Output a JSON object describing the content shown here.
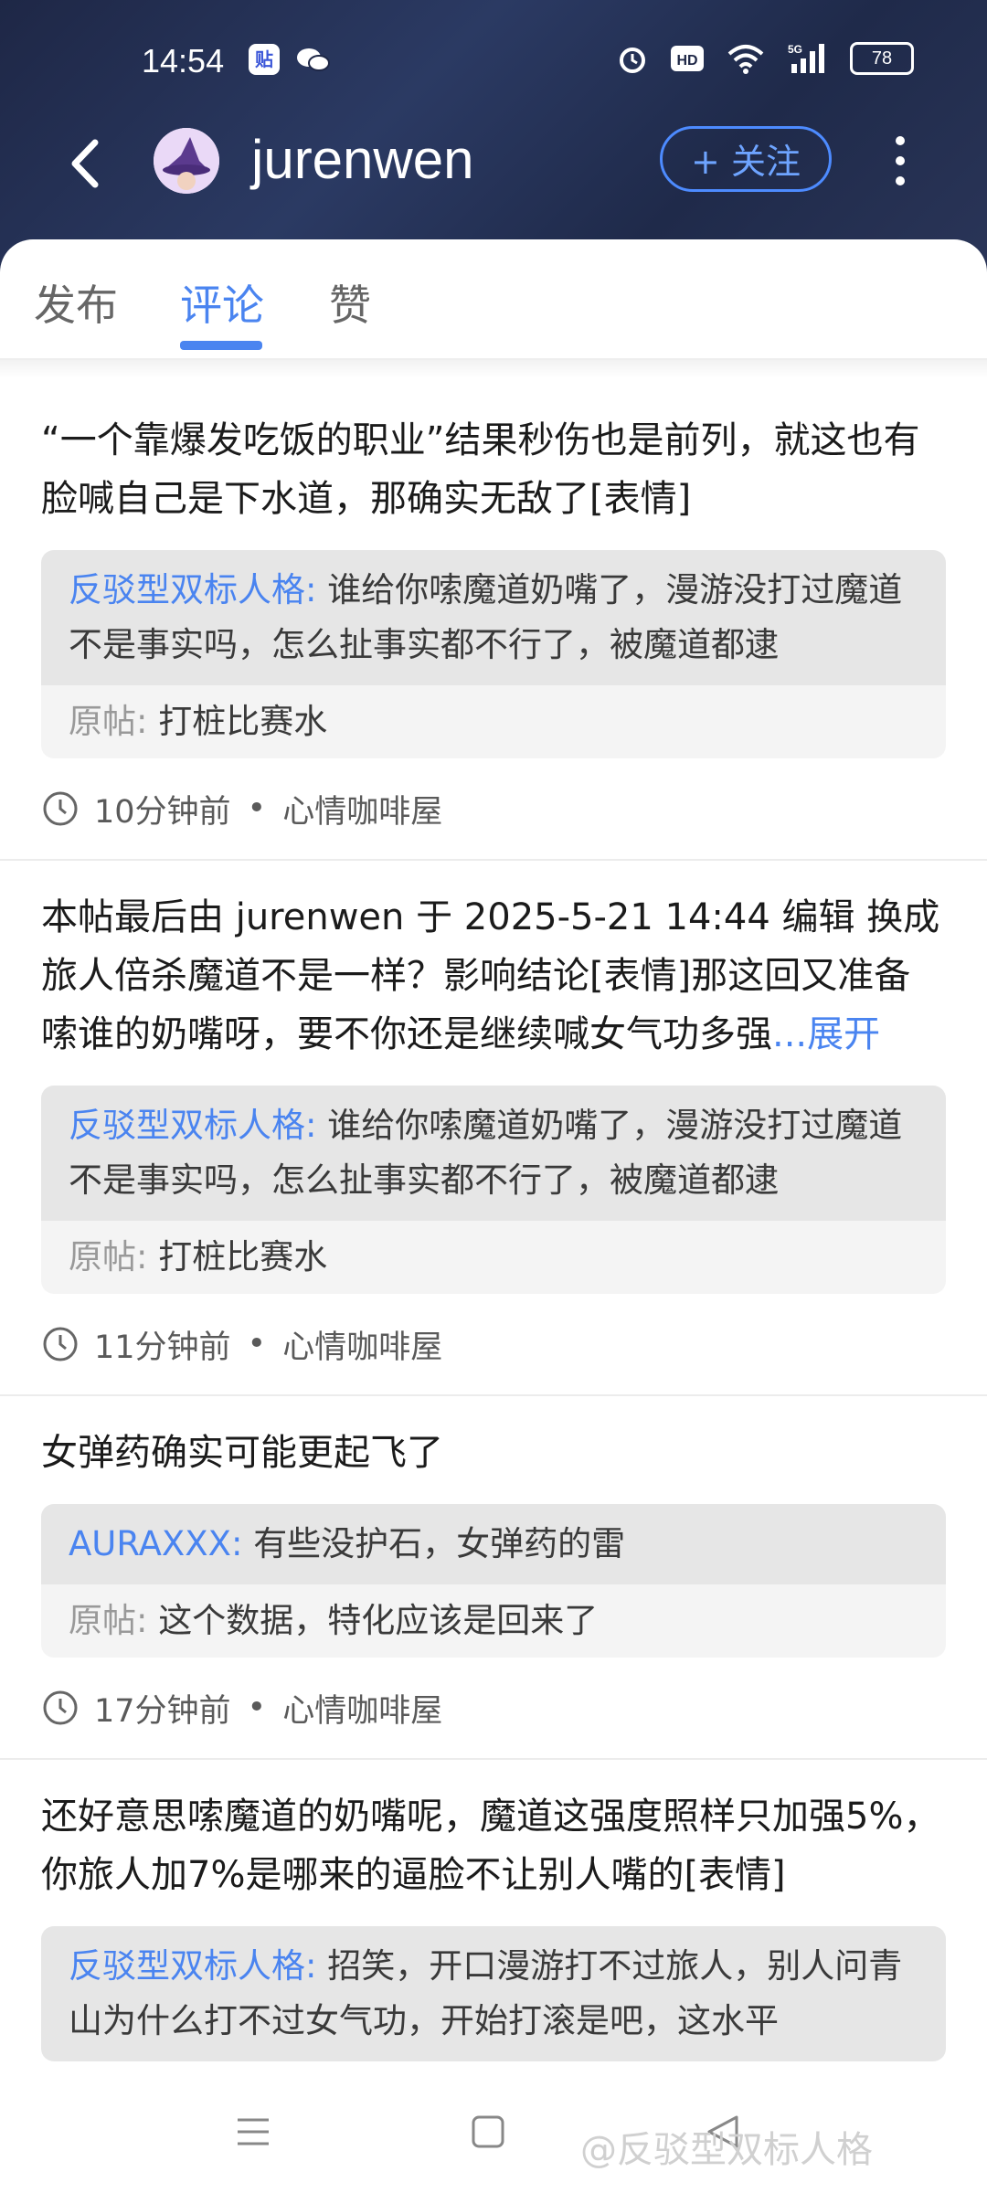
{
  "status_bar": {
    "time": "14:54",
    "app_icon_label": "贴",
    "signal_label": "5G",
    "battery": "78"
  },
  "header": {
    "username": "jurenwen",
    "follow_label": "+ 关注"
  },
  "tabs": [
    {
      "label": "发布"
    },
    {
      "label": "评论"
    },
    {
      "label": "赞"
    }
  ],
  "posts": [
    {
      "text": "“一个靠爆发吃饭的职业”结果秒伤也是前列，就这也有脸喊自己是下水道，那确实无敌了[表情]",
      "expand_label": "",
      "reply_name": "反驳型双标人格:",
      "reply_text": "谁给你嗦魔道奶嘴了，漫游没打过魔道不是事实吗，怎么扯事实都不行了，被魔道都逮",
      "orig_label": "原帖:",
      "orig_text": "打桩比赛水",
      "time": "10分钟前",
      "forum": "心情咖啡屋"
    },
    {
      "text": "本帖最后由 jurenwen 于 2025-5-21 14:44 编辑 换成旅人倍杀魔道不是一样？影响结论[表情]那这回又准备嗦谁的奶嘴呀，要不你还是继续喊女气功多强",
      "expand_label": "...展开",
      "reply_name": "反驳型双标人格:",
      "reply_text": "谁给你嗦魔道奶嘴了，漫游没打过魔道不是事实吗，怎么扯事实都不行了，被魔道都逮",
      "orig_label": "原帖:",
      "orig_text": "打桩比赛水",
      "time": "11分钟前",
      "forum": "心情咖啡屋"
    },
    {
      "text": "女弹药确实可能更起飞了",
      "expand_label": "",
      "reply_name": "AURAXXX:",
      "reply_text": "有些没护石，女弹药的雷",
      "orig_label": "原帖:",
      "orig_text": "这个数据，特化应该是回来了",
      "time": "17分钟前",
      "forum": "心情咖啡屋"
    },
    {
      "text": "还好意思嗦魔道的奶嘴呢，魔道这强度照样只加强5%，你旅人加7%是哪来的逼脸不让别人嘴的[表情]",
      "expand_label": "",
      "reply_name": "反驳型双标人格:",
      "reply_text": "招笑，开口漫游打不过旅人，别人问青山为什么打不过女气功，开始打滚是吧，这水平",
      "orig_label": "",
      "orig_text": "",
      "time": "",
      "forum": ""
    }
  ],
  "meta_separator": "•",
  "watermark": "@反驳型双标人格",
  "accent_color": "#4a84f0"
}
